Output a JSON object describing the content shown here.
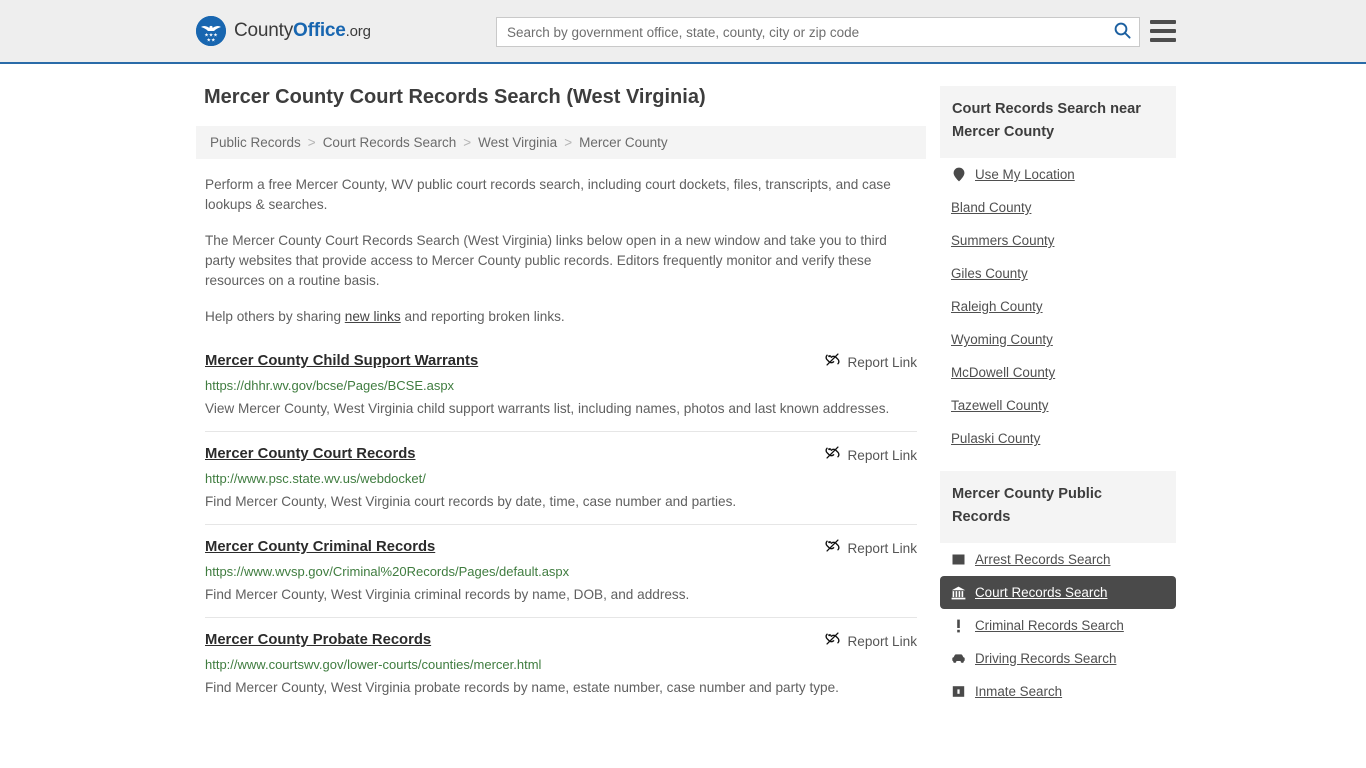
{
  "header": {
    "logo": {
      "part1": "County",
      "part2": "Office",
      "part3": ".org",
      "icon": "eagle-shield-logo"
    },
    "search": {
      "placeholder": "Search by government office, state, county, city or zip code",
      "value": "",
      "icon": "search-icon"
    },
    "menu_icon": "hamburger-menu-icon",
    "border_color": "#2a6ba8",
    "background": "#eeeeee"
  },
  "main": {
    "title": "Mercer County Court Records Search (West Virginia)",
    "breadcrumb": [
      "Public Records",
      "Court Records Search",
      "West Virginia",
      "Mercer County"
    ],
    "breadcrumb_separator": ">",
    "intro": [
      "Perform a free Mercer County, WV public court records search, including court dockets, files, transcripts, and case lookups & searches.",
      "The Mercer County Court Records Search (West Virginia) links below open in a new window and take you to third party websites that provide access to Mercer County public records. Editors frequently monitor and verify these resources on a routine basis."
    ],
    "help_line": {
      "before": "Help others by sharing ",
      "link": "new links",
      "after": " and reporting broken links."
    },
    "report_link_label": "Report Link",
    "report_link_icon": "broken-link-icon",
    "results": [
      {
        "title": "Mercer County Child Support Warrants",
        "url": "https://dhhr.wv.gov/bcse/Pages/BCSE.aspx",
        "description": "View Mercer County, West Virginia child support warrants list, including names, photos and last known addresses."
      },
      {
        "title": "Mercer County Court Records",
        "url": "http://www.psc.state.wv.us/webdocket/",
        "description": "Find Mercer County, West Virginia court records by date, time, case number and parties."
      },
      {
        "title": "Mercer County Criminal Records",
        "url": "https://www.wvsp.gov/Criminal%20Records/Pages/default.aspx",
        "description": "Find Mercer County, West Virginia criminal records by name, DOB, and address."
      },
      {
        "title": "Mercer County Probate Records",
        "url": "http://www.courtswv.gov/lower-courts/counties/mercer.html",
        "description": "Find Mercer County, West Virginia probate records by name, estate number, case number and party type."
      }
    ]
  },
  "sidebar": {
    "nearby": {
      "heading": "Court Records Search near Mercer County",
      "items": [
        {
          "label": "Use My Location",
          "icon": "map-pin-icon"
        },
        {
          "label": "Bland County",
          "icon": null
        },
        {
          "label": "Summers County",
          "icon": null
        },
        {
          "label": "Giles County",
          "icon": null
        },
        {
          "label": "Raleigh County",
          "icon": null
        },
        {
          "label": "Wyoming County",
          "icon": null
        },
        {
          "label": "McDowell County",
          "icon": null
        },
        {
          "label": "Tazewell County",
          "icon": null
        },
        {
          "label": "Pulaski County",
          "icon": null
        }
      ]
    },
    "public_records": {
      "heading": "Mercer County Public Records",
      "active_index": 1,
      "active_color": "#4a4a4a",
      "items": [
        {
          "label": "Arrest Records Search",
          "icon": "fingerprint-square-icon"
        },
        {
          "label": "Court Records Search",
          "icon": "courthouse-icon"
        },
        {
          "label": "Criminal Records Search",
          "icon": "exclamation-icon"
        },
        {
          "label": "Driving Records Search",
          "icon": "car-icon"
        },
        {
          "label": "Inmate Search",
          "icon": "jail-icon"
        }
      ]
    }
  }
}
